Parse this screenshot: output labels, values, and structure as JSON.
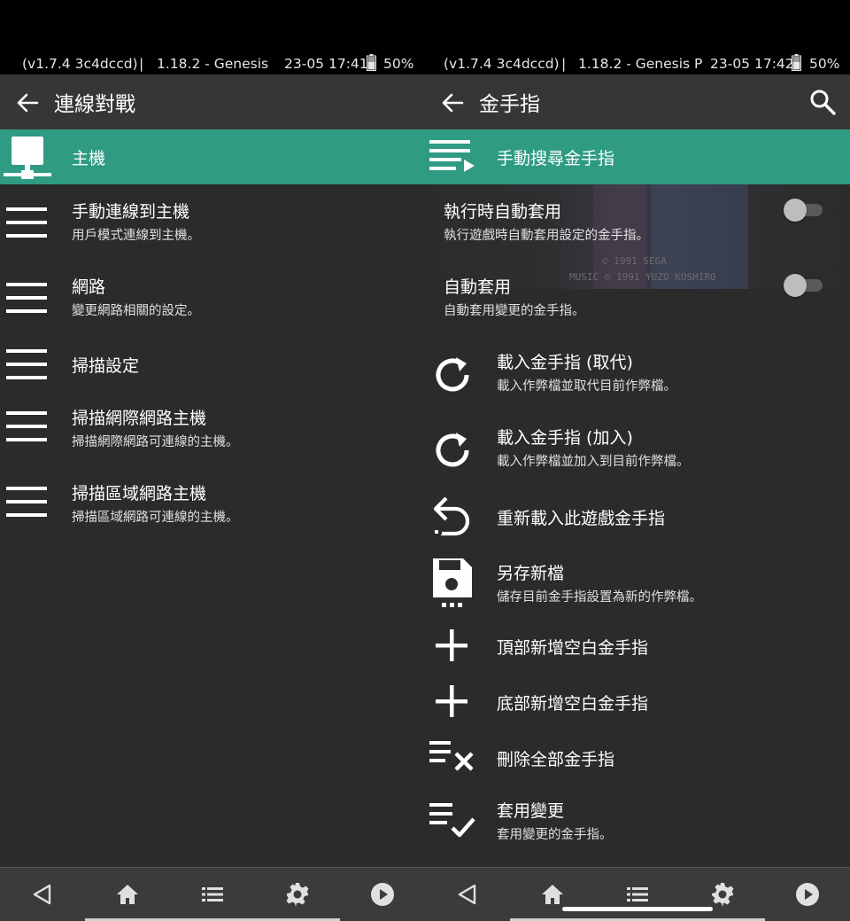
{
  "left": {
    "status": {
      "version": "(v1.7.4 3c4dccd)",
      "separator": "|",
      "core": "1.18.2 - Genesis",
      "time": "23-05 17:41",
      "battery": "50%"
    },
    "appbar": {
      "title": "連線對戰",
      "back_icon": "arrow-back-icon"
    },
    "items": [
      {
        "label": "主機",
        "sub": "",
        "icon": "host-network-icon",
        "selected": true
      },
      {
        "label": "手動連線到主機",
        "sub": "用戶模式連線到主機。",
        "icon": "menu-lines-icon"
      },
      {
        "label": "網路",
        "sub": "變更網路相關的設定。",
        "icon": "menu-lines-icon"
      },
      {
        "label": "掃描設定",
        "sub": "",
        "icon": "menu-lines-icon"
      },
      {
        "label": "掃描網際網路主機",
        "sub": "掃描網際網路可連線的主機。",
        "icon": "menu-lines-icon"
      },
      {
        "label": "掃描區域網路主機",
        "sub": "掃描區域網路可連線的主機。",
        "icon": "menu-lines-icon"
      }
    ]
  },
  "right": {
    "status": {
      "version": "(v1.7.4 3c4dccd)",
      "separator": "|",
      "core": "1.18.2 - Genesis P",
      "time": "23-05 17:42",
      "battery": "50%"
    },
    "appbar": {
      "title": "金手指",
      "back_icon": "arrow-back-icon",
      "search_icon": "search-icon"
    },
    "game_credits": [
      "© 1991 SEGA",
      "MUSIC © 1991 YUZO KOSHIRO"
    ],
    "items": [
      {
        "label": "手動搜尋金手指",
        "sub": "",
        "icon": "playlist-play-icon",
        "selected": true
      },
      {
        "label": "執行時自動套用",
        "sub": "執行遊戲時自動套用設定的金手指。",
        "toggle": false
      },
      {
        "label": "自動套用",
        "sub": "自動套用變更的金手指。",
        "toggle": false
      },
      {
        "label": "載入金手指 (取代)",
        "sub": "載入作弊檔並取代目前作弊檔。",
        "icon": "reload-icon"
      },
      {
        "label": "載入金手指 (加入)",
        "sub": "載入作弊檔並加入到目前作弊檔。",
        "icon": "reload-icon"
      },
      {
        "label": "重新載入此遊戲金手指",
        "sub": "",
        "icon": "undo-icon"
      },
      {
        "label": "另存新檔",
        "sub": "儲存目前金手指設置為新的作弊檔。",
        "icon": "save-icon"
      },
      {
        "label": "頂部新增空白金手指",
        "sub": "",
        "icon": "plus-icon"
      },
      {
        "label": "底部新增空白金手指",
        "sub": "",
        "icon": "plus-icon"
      },
      {
        "label": "刪除全部金手指",
        "sub": "",
        "icon": "clear-list-icon"
      },
      {
        "label": "套用變更",
        "sub": "套用變更的金手指。",
        "icon": "list-check-icon"
      }
    ]
  },
  "navbar": {
    "buttons": [
      "back-triangle-icon",
      "home-icon",
      "list-icon",
      "gear-icon",
      "play-circle-icon"
    ]
  },
  "colors": {
    "accent": "#2e9b82",
    "background": "#2b2b2b",
    "appbar": "#363636",
    "navbar": "#3b3b3b"
  }
}
